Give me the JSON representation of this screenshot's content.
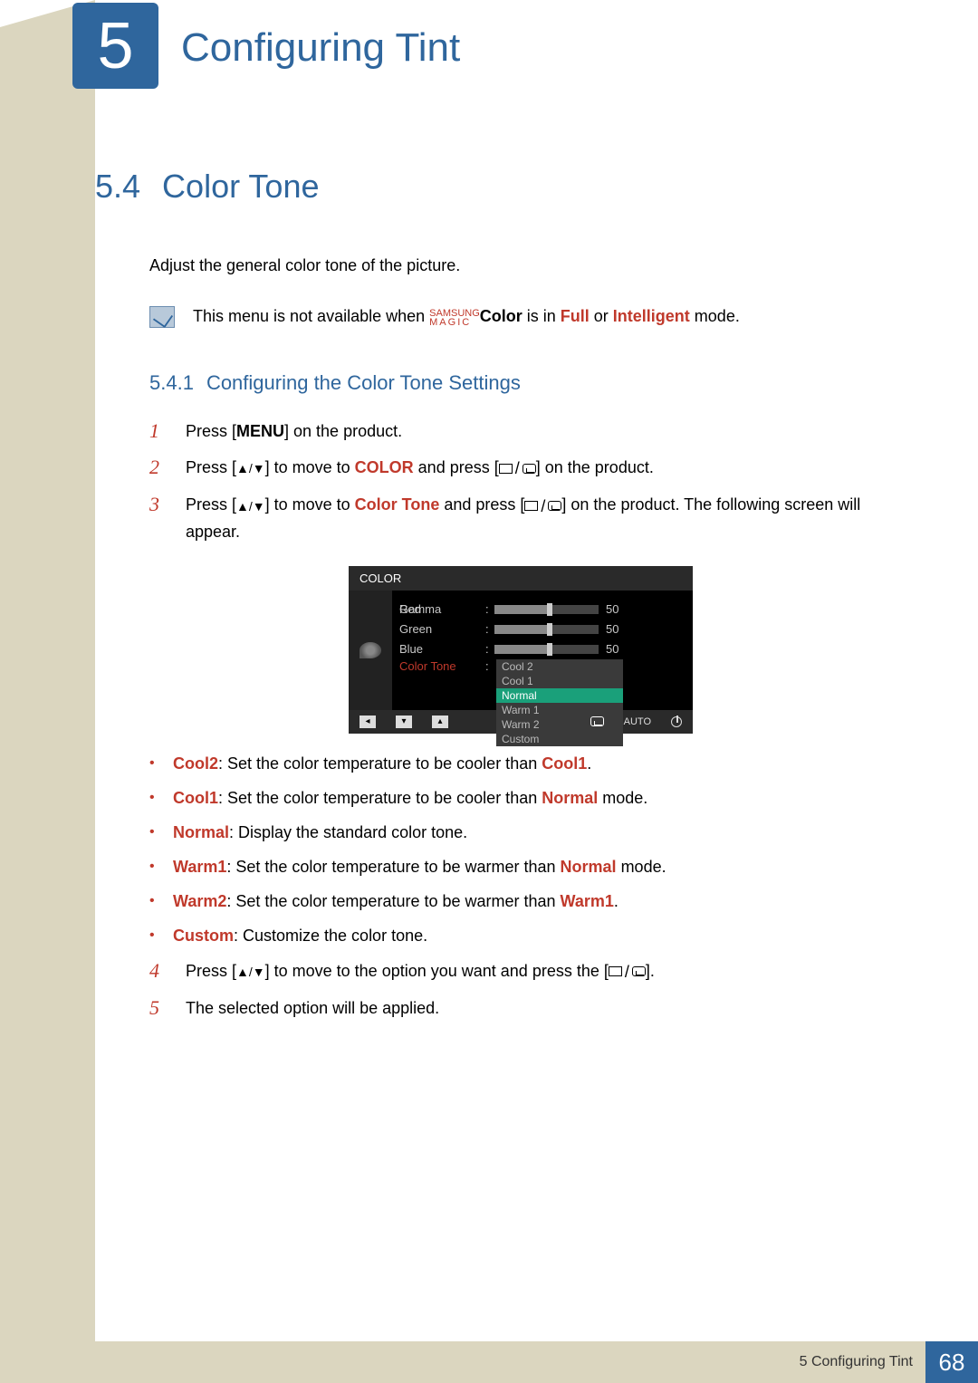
{
  "chapter": {
    "number": "5",
    "title": "Configuring Tint"
  },
  "section": {
    "number": "5.4",
    "title": "Color Tone"
  },
  "intro": "Adjust the general color tone of the picture.",
  "note": {
    "pre": "This menu is not available when ",
    "magic_top": "SAMSUNG",
    "magic_bot": "MAGIC",
    "color_word": "Color",
    "mid": " is in ",
    "full": "Full",
    "or": " or ",
    "intel": "Intelligent",
    "post": " mode."
  },
  "subsection": {
    "number": "5.4.1",
    "title": "Configuring the  Color Tone Settings"
  },
  "steps": {
    "s1": {
      "n": "1",
      "a": "Press [",
      "menu": "MENU",
      "b": "] on the product."
    },
    "s2": {
      "n": "2",
      "a": "Press [",
      "b": "] to move to ",
      "color": "COLOR",
      "c": " and press [",
      "d": "] on the product."
    },
    "s3": {
      "n": "3",
      "a": "Press [",
      "b": "] to move to ",
      "ct": "Color Tone",
      "c": " and press [",
      "d": "] on the product. The following screen will appear."
    },
    "s4": {
      "n": "4",
      "a": "Press [",
      "b": "] to move to the option you want and press the [",
      "c": "]."
    },
    "s5": {
      "n": "5",
      "a": "The selected option will be applied."
    }
  },
  "osd": {
    "title": "COLOR",
    "rows": {
      "red": {
        "label": "Red",
        "value": "50",
        "pct": 50
      },
      "green": {
        "label": "Green",
        "value": "50",
        "pct": 50
      },
      "blue": {
        "label": "Blue",
        "value": "50",
        "pct": 50
      }
    },
    "colortone_label": "Color Tone",
    "gamma_label": "Gamma",
    "options": [
      "Cool 2",
      "Cool 1",
      "Normal",
      "Warm 1",
      "Warm 2",
      "Custom"
    ],
    "selected": "Normal",
    "footer_auto": "AUTO"
  },
  "bullets": {
    "b1": {
      "k": "Cool2",
      "t1": ": Set the color temperature to be cooler than ",
      "r": "Cool1",
      "t2": "."
    },
    "b2": {
      "k": "Cool1",
      "t1": ": Set the color temperature to be cooler than ",
      "r": "Normal",
      "t2": " mode."
    },
    "b3": {
      "k": "Normal",
      "t1": ": Display the standard color tone.",
      "r": "",
      "t2": ""
    },
    "b4": {
      "k": "Warm1",
      "t1": ": Set the color temperature to be warmer than ",
      "r": "Normal",
      "t2": " mode."
    },
    "b5": {
      "k": "Warm2",
      "t1": ": Set the color temperature to be warmer than ",
      "r": "Warm1",
      "t2": "."
    },
    "b6": {
      "k": "Custom",
      "t1": ": Customize the color tone.",
      "r": "",
      "t2": ""
    }
  },
  "footer": {
    "crumb": "5 Configuring Tint",
    "page": "68"
  }
}
